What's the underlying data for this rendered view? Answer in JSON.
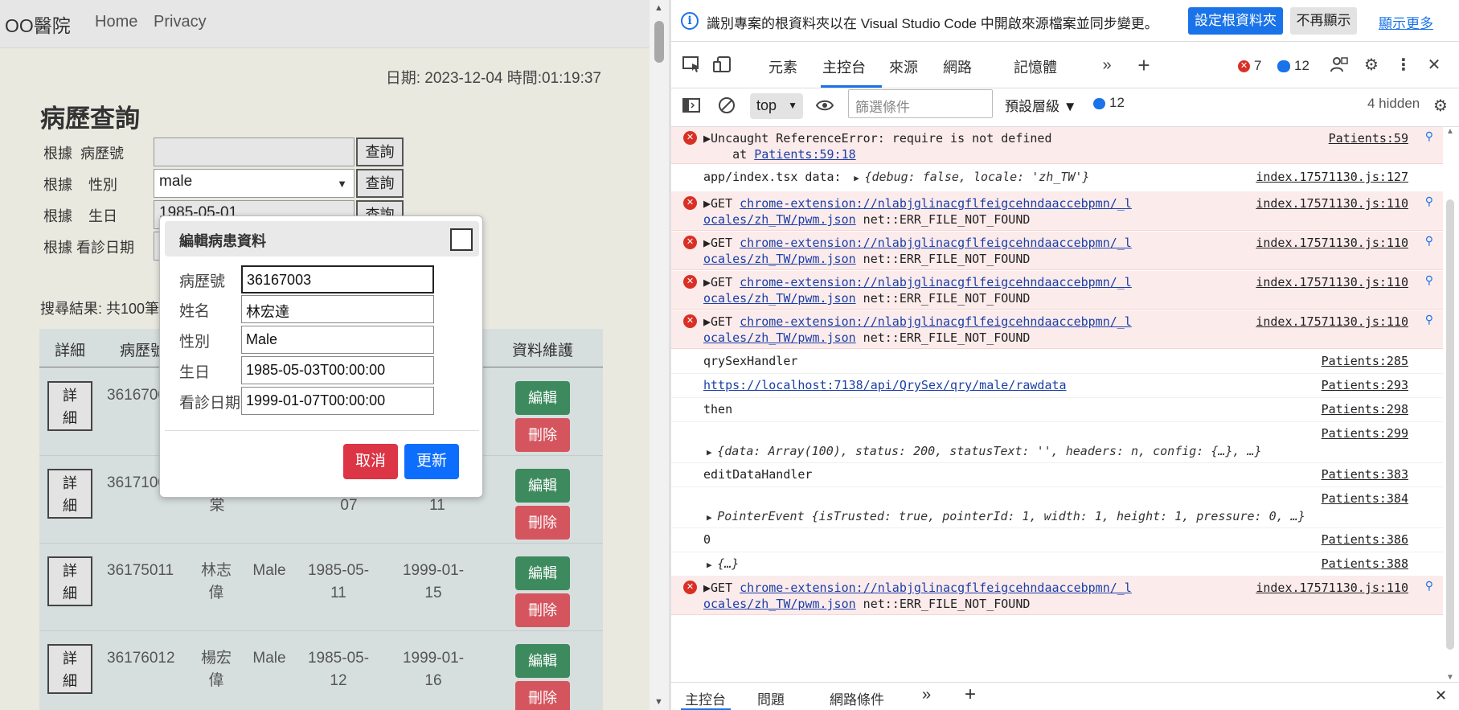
{
  "app": {
    "brand": "OO醫院",
    "nav": {
      "home": "Home",
      "privacy": "Privacy"
    },
    "datetime": "日期: 2023-12-04 時間:01:19:37",
    "page_title": "病歷查詢",
    "query": {
      "rows": [
        {
          "label": "根據  病歷號",
          "value": "",
          "button": "查詢"
        },
        {
          "label": "根據    性別",
          "value": "male",
          "button": "查詢"
        },
        {
          "label": "根據    生日",
          "value": "1985-05-01",
          "button": "查詢"
        },
        {
          "label": "根據 看診日期",
          "value": "",
          "button": ""
        }
      ]
    },
    "result_text": "搜尋結果: 共100筆",
    "table": {
      "headers": {
        "detail": "詳細",
        "id": "病歷號",
        "maint": "資料維護"
      },
      "rows": [
        {
          "detail": "詳\n細",
          "id": "3616700",
          "name": "",
          "sex": "",
          "birth": "",
          "visit": "",
          "edit": "編輯",
          "del": "刪除"
        },
        {
          "detail": "詳\n細",
          "id": "3617100",
          "name": "棠",
          "sex": "",
          "birth": "07",
          "visit": "11",
          "edit": "編輯",
          "del": "刪除"
        },
        {
          "detail": "詳\n細",
          "id": "36175011",
          "name": "林志\n偉",
          "sex": "Male",
          "birth": "1985-05-\n11",
          "visit": "1999-01-\n15",
          "edit": "編輯",
          "del": "刪除"
        },
        {
          "detail": "詳\n細",
          "id": "36176012",
          "name": "楊宏\n偉",
          "sex": "Male",
          "birth": "1985-05-\n12",
          "visit": "1999-01-\n16",
          "edit": "編輯",
          "del": "刪除"
        }
      ]
    },
    "modal": {
      "title": "編輯病患資料",
      "fields": [
        {
          "label": "病歷號",
          "value": "36167003"
        },
        {
          "label": "姓名",
          "value": "林宏達"
        },
        {
          "label": "性別",
          "value": "Male"
        },
        {
          "label": "生日",
          "value": "1985-05-03T00:00:00"
        },
        {
          "label": "看診日期",
          "value": "1999-01-07T00:00:00"
        }
      ],
      "cancel": "取消",
      "update": "更新"
    }
  },
  "devtools": {
    "infobar": {
      "text": "識別專案的根資料夾以在 Visual Studio Code 中開啟來源檔案並同步變更。",
      "set_root": "設定根資料夾",
      "dont_show": "不再顯示",
      "more": "顯示更多"
    },
    "tabs": {
      "elements": "元素",
      "console": "主控台",
      "sources": "來源",
      "network": "網路",
      "memory": "記憶體"
    },
    "error_count": "7",
    "message_count": "12",
    "toolbar": {
      "context": "top",
      "filter_placeholder": "篩選條件",
      "levels": "預設層級 ▼",
      "levels_count": "12",
      "hidden": "4 hidden"
    },
    "drawer": {
      "console": "主控台",
      "issues": "問題",
      "network_conditions": "網路條件"
    },
    "console": {
      "uncaught_line1": "▶Uncaught ReferenceError: require is not defined",
      "uncaught_line2_prefix": "    at ",
      "uncaught_line2_link": "Patients:59:18",
      "uncaught_src": "Patients:59",
      "app_label": "app/index.tsx data: ",
      "app_obj": "{debug: false, locale: 'zh_TW'}",
      "app_src": "index.17571130.js:127",
      "get_prefix": "▶GET ",
      "get_url1": "chrome-extension://nlabjglinacgflfeigcehndaaccebpmn/_l",
      "get_url2": "ocales/zh_TW/pwm.json",
      "get_err": " net::ERR_FILE_NOT_FOUND",
      "get_src": "index.17571130.js:110",
      "qry": "qrySexHandler",
      "qry_src": "Patients:285",
      "api_url": "https://localhost:7138/api/QrySex/qry/male/rawdata",
      "api_src": "Patients:293",
      "then": "then",
      "then_src": "Patients:298",
      "data_src": "Patients:299",
      "data_obj": "{data: Array(100), status: 200, statusText: '', headers: n, config: {…}, …}",
      "edit": "editDataHandler",
      "edit_src": "Patients:383",
      "pointer_src": "Patients:384",
      "pointer_obj": "PointerEvent {isTrusted: true, pointerId: 1, width: 1, height: 1, pressure: 0, …}",
      "zero": "0",
      "zero_src": "Patients:386",
      "ellipsis_obj": "{…}",
      "ellipsis_src": "Patients:388"
    }
  }
}
